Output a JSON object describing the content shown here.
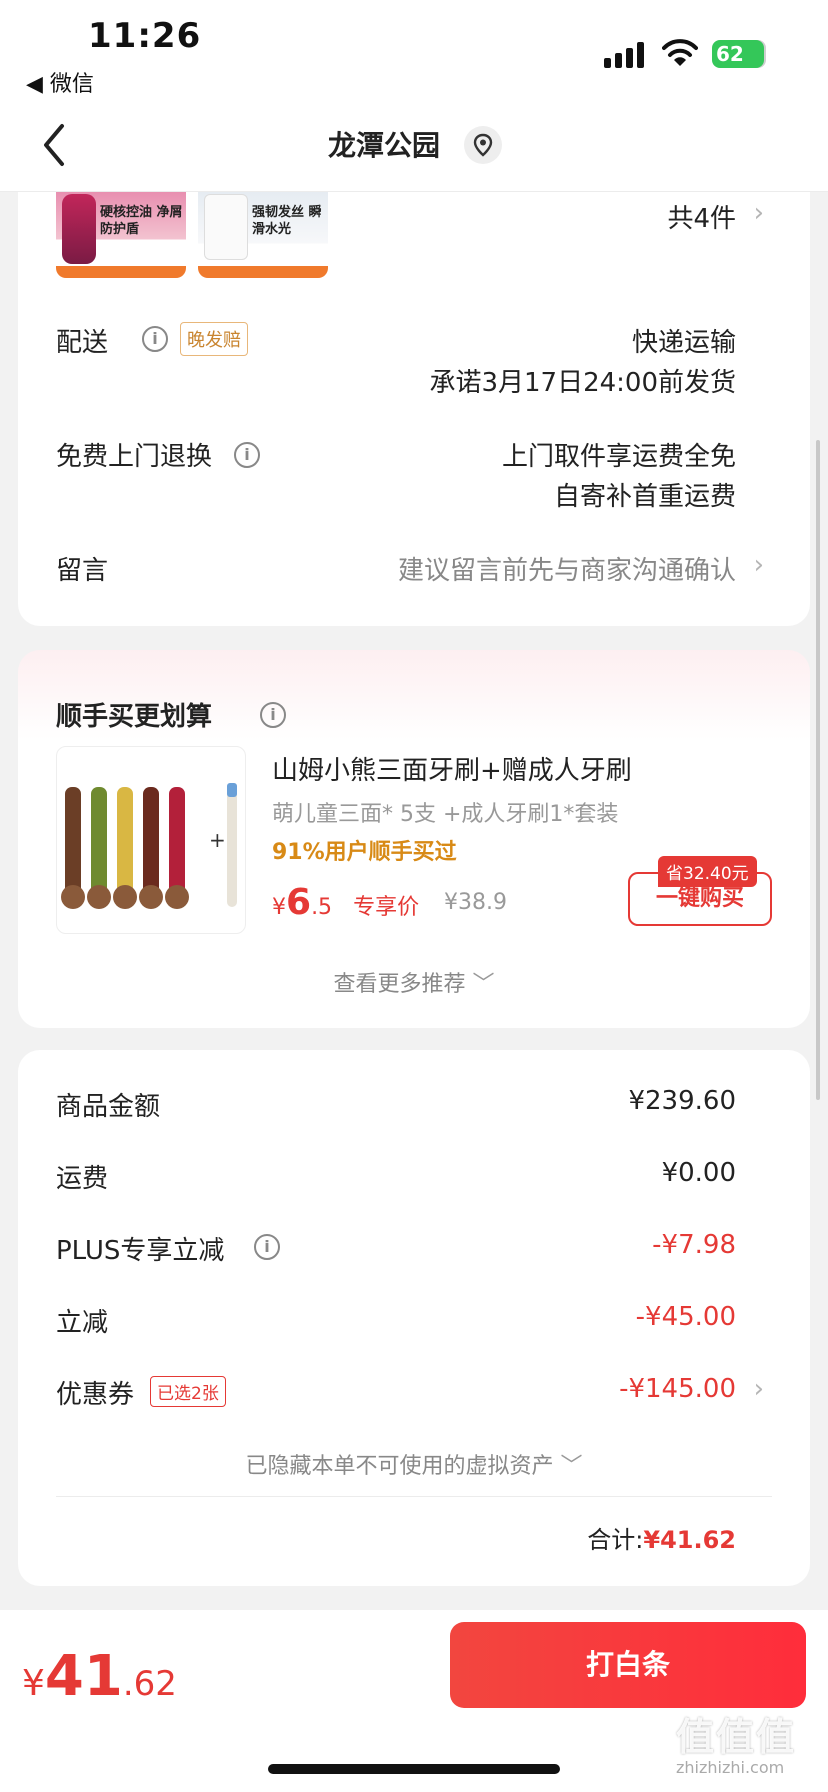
{
  "status_bar": {
    "time": "11:26",
    "back_app": "◀ 微信",
    "battery": "62"
  },
  "nav": {
    "title": "龙潭公园"
  },
  "items": {
    "count": "共4件",
    "thumb1_text": "硬核控油 净屑防护盾",
    "thumb2_text": "强韧发丝 瞬滑水光"
  },
  "delivery": {
    "label": "配送",
    "tag": "晚发赔",
    "method": "快递运输",
    "promise": "承诺3月17日24:00前发货"
  },
  "returns": {
    "label": "免费上门退换",
    "line1": "上门取件享运费全免",
    "line2": "自寄补首重运费"
  },
  "message": {
    "label": "留言",
    "placeholder": "建议留言前先与商家沟通确认"
  },
  "upsell": {
    "title": "顺手买更划算",
    "name": "山姆小熊三面牙刷+赠成人牙刷",
    "sub": "萌儿童三面* 5支 +成人牙刷1*套装",
    "buy_pct": "91%用户顺手买过",
    "price_int": "6",
    "price_dec": ".5",
    "price_label": "专享价",
    "original": "¥38.9",
    "save": "省32.40元",
    "buy_button": "一键购买",
    "more": "查看更多推荐"
  },
  "totals": {
    "goods_label": "商品金额",
    "goods_value": "¥239.60",
    "shipping_label": "运费",
    "shipping_value": "¥0.00",
    "plus_label": "PLUS专享立减",
    "plus_value": "-¥7.98",
    "discount_label": "立减",
    "discount_value": "-¥45.00",
    "coupon_label": "优惠券",
    "coupon_tag": "已选2张",
    "coupon_value": "-¥145.00",
    "hidden_assets": "已隐藏本单不可使用的虚拟资产",
    "sum_label": "合计:",
    "sum_value": "¥41.62"
  },
  "bottom": {
    "currency": "¥",
    "price_int": "41",
    "price_dec": ".62",
    "pay_button": "打白条"
  },
  "watermark": {
    "brand": "值值值",
    "site": "zhizhizhi.com"
  },
  "colors": {
    "accent_red": "#e53935",
    "warn_orange": "#d88a16",
    "battery_green": "#34c759"
  }
}
